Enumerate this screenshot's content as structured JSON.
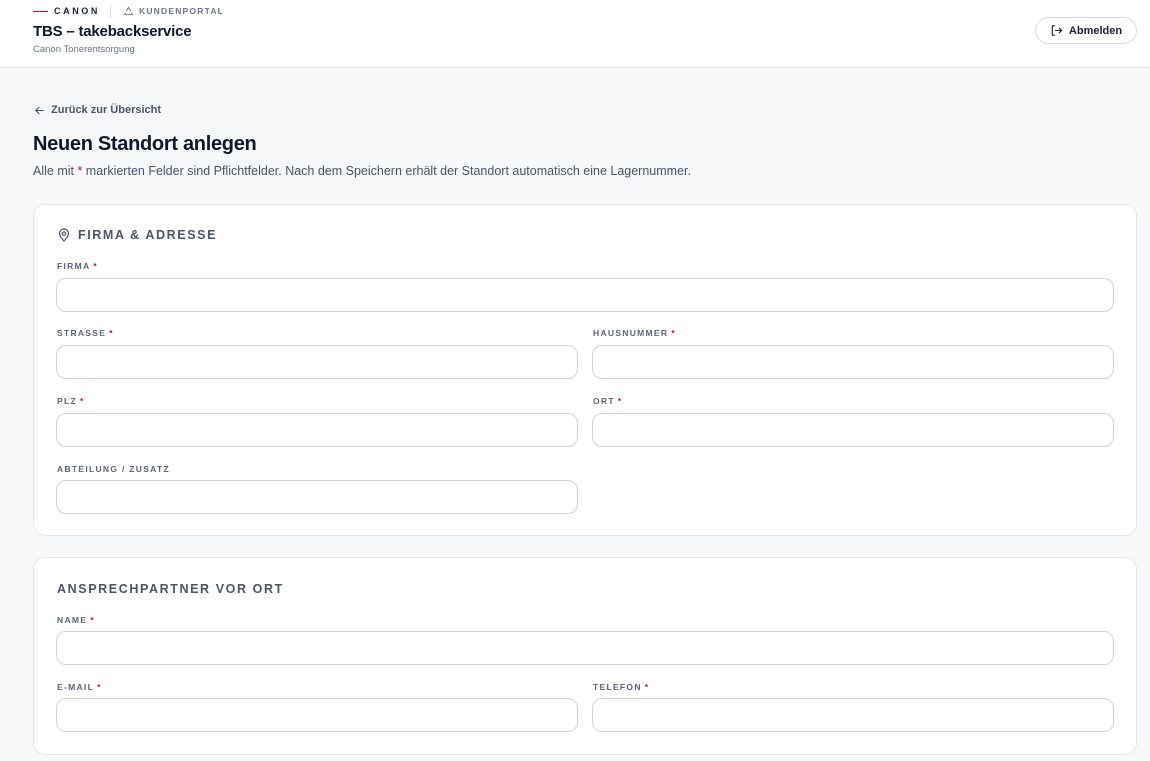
{
  "header": {
    "brand": "CANON",
    "portal": "KUNDENPORTAL",
    "title": "TBS – takebackservice",
    "subtitle": "Canon Tonerentsorgung",
    "logout_label": "Abmelden"
  },
  "nav": {
    "back_label": "Zurück zur Übersicht"
  },
  "page": {
    "title": "Neuen Standort anlegen",
    "desc_before": "Alle mit ",
    "desc_star": "*",
    "desc_after": " markierten Felder sind Pflichtfelder. Nach dem Speichern erhält der Standort automatisch eine Lagernummer."
  },
  "sections": {
    "address": {
      "title": "FIRMA & ADRESSE",
      "icon": "map-pin-icon",
      "fields": {
        "firma": {
          "label": "FIRMA",
          "required": "*",
          "value": ""
        },
        "strasse": {
          "label": "STRASSE",
          "required": "*",
          "value": ""
        },
        "hausnummer": {
          "label": "HAUSNUMMER",
          "required": "*",
          "value": ""
        },
        "plz": {
          "label": "PLZ",
          "required": "*",
          "value": ""
        },
        "ort": {
          "label": "ORT",
          "required": "*",
          "value": ""
        },
        "abteilung": {
          "label": "ABTEILUNG / ZUSATZ",
          "value": ""
        }
      }
    },
    "contact": {
      "title": "ANSPRECHPARTNER VOR ORT",
      "fields": {
        "name": {
          "label": "NAME",
          "required": "*",
          "value": ""
        },
        "email": {
          "label": "E-MAIL",
          "required": "*",
          "value": ""
        },
        "telefon": {
          "label": "TELEFON",
          "required": "*",
          "value": ""
        }
      }
    }
  },
  "colors": {
    "accent": "#c8102e",
    "text": "#0f1829",
    "muted": "#6b7687",
    "border": "#cfd4dc"
  }
}
